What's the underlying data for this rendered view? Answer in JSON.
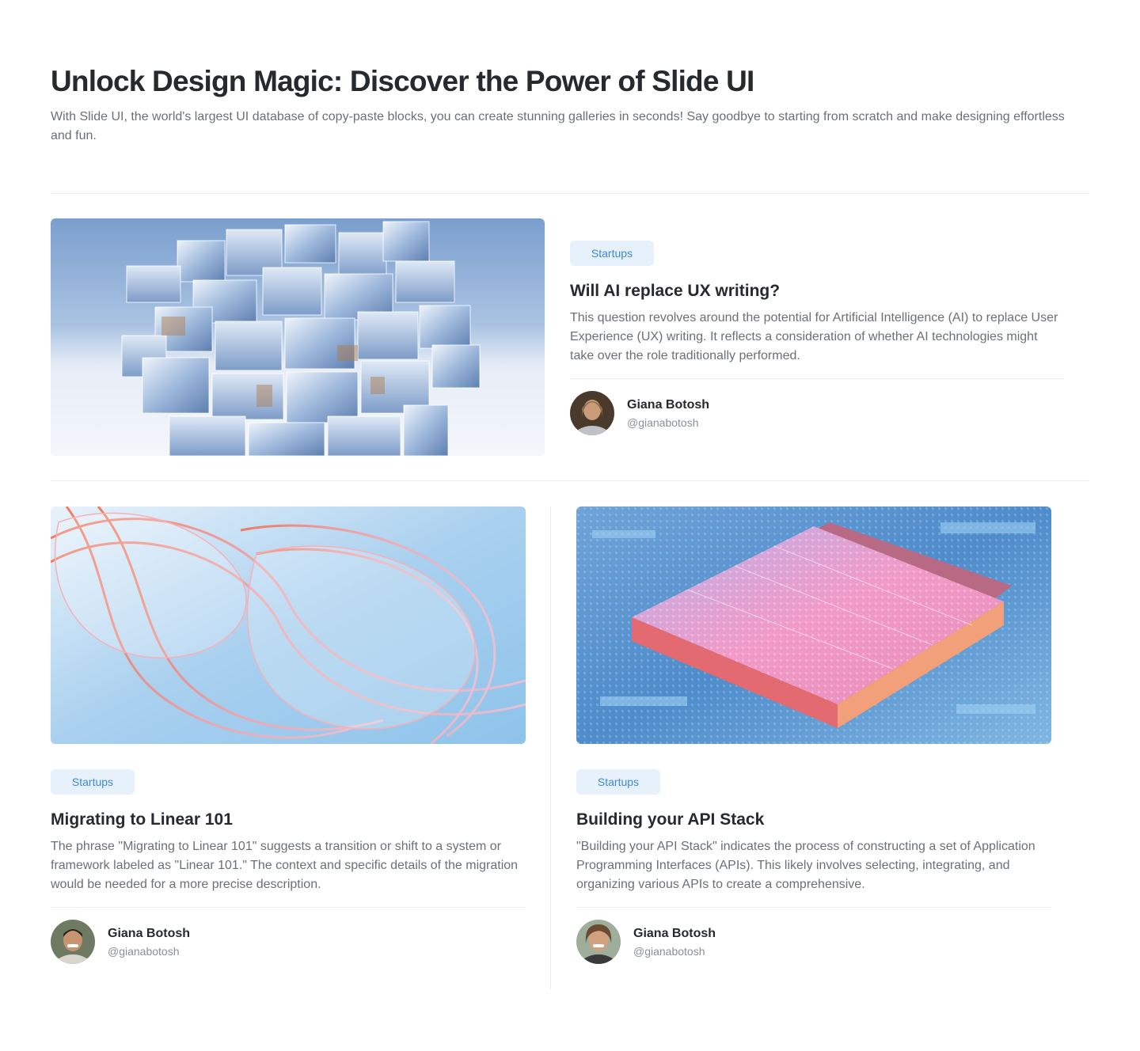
{
  "header": {
    "title": "Unlock Design Magic: Discover the Power of Slide UI",
    "subtitle": "With Slide UI, the world's largest UI database of copy-paste blocks, you can create stunning galleries in seconds! Say goodbye to starting from scratch and make designing effortless and fun."
  },
  "posts": [
    {
      "tag": "Startups",
      "title": "Will AI replace UX writing?",
      "description": "This question revolves around the potential for Artificial Intelligence (AI) to replace User Experience (UX) writing. It reflects a consideration of whether AI technologies might take over the role traditionally performed.",
      "author": {
        "name": "Giana Botosh",
        "handle": "@gianabotosh"
      }
    },
    {
      "tag": "Startups",
      "title": "Migrating to Linear 101",
      "description": "The phrase \"Migrating to Linear 101\" suggests a transition or shift to a system or framework labeled as \"Linear 101.\" The context and specific details of the migration would be needed for a more precise description.",
      "author": {
        "name": "Giana Botosh",
        "handle": "@gianabotosh"
      }
    },
    {
      "tag": "Startups",
      "title": "Building your API Stack",
      "description": "\"Building your API Stack\" indicates the process of constructing a set of Application Programming Interfaces (APIs). This likely involves selecting, integrating, and organizing various APIs to create a comprehensive.",
      "author": {
        "name": "Giana Botosh",
        "handle": "@gianabotosh"
      }
    }
  ],
  "colors": {
    "tag_bg": "#e6f1fc",
    "tag_text": "#3f8ad8",
    "heading": "#26292d",
    "body_text": "#6b7075",
    "divider": "#ececec"
  }
}
